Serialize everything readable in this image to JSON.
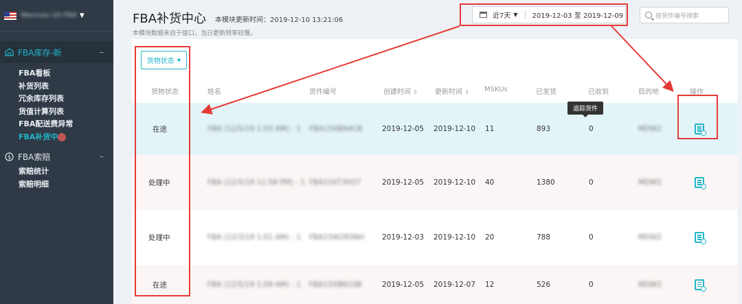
{
  "sidebar": {
    "store_name": "Warsvas US-FBA",
    "groups": [
      {
        "label": "FBA库存-新",
        "toggle": "–",
        "items": [
          "FBA看板",
          "补货列表",
          "冗余库存列表",
          "货值计算列表",
          "FBA配送费异常",
          "FBA补货中心"
        ]
      },
      {
        "label": "FBA索赔",
        "toggle": "–",
        "items": [
          "索赔统计",
          "索赔明细"
        ]
      }
    ]
  },
  "header": {
    "title": "FBA补货中心",
    "update_time": "本模块更新时间：2019-12-10 13:21:06",
    "note": "本模块数据来自于接口，当日更新频率较慢。"
  },
  "date_filter": {
    "preset": "近7天",
    "range": "2019-12-03 至 2019-12-09"
  },
  "search": {
    "placeholder": "按货件编号搜索"
  },
  "status_filter": {
    "label": "货物状态"
  },
  "table": {
    "columns": [
      "货物状态",
      "姓名",
      "货件编号",
      "创建时间",
      "更新时间",
      "MSKUs",
      "已发货",
      "已收到",
      "目的地",
      "操作"
    ],
    "sort_glyph": "⇕",
    "rows": [
      {
        "status": "在途",
        "name": "FBA (12/5/19 1:03 AM) - 1",
        "shipment_id": "FBA15XBN4CB",
        "created": "2019-12-05",
        "updated": "2019-12-10",
        "mskus": "11",
        "shipped": "893",
        "received": "0",
        "destination": "MDW2"
      },
      {
        "status": "处理中",
        "name": "FBA (12/5/19 11:58 PM) - 1",
        "shipment_id": "FBA15XT3H37",
        "created": "2019-12-05",
        "updated": "2019-12-10",
        "mskus": "40",
        "shipped": "1380",
        "received": "0",
        "destination": "MDW2"
      },
      {
        "status": "处理中",
        "name": "FBA (12/3/19 1:01 AM) - 1",
        "shipment_id": "FBA15W2R0NH",
        "created": "2019-12-03",
        "updated": "2019-12-10",
        "mskus": "20",
        "shipped": "788",
        "received": "0",
        "destination": "MDW2"
      },
      {
        "status": "在途",
        "name": "FBA (12/5/19 1:09 AM) - 1",
        "shipment_id": "FBA15XBN10B",
        "created": "2019-12-05",
        "updated": "2019-12-07",
        "mskus": "12",
        "shipped": "526",
        "received": "0",
        "destination": "MDW2"
      }
    ]
  },
  "tooltip": {
    "label": "追踪货件"
  },
  "icons": {
    "store_flag": "us-flag-icon",
    "warehouse": "warehouse-icon",
    "claims": "dollar-circle-icon",
    "calendar": "calendar-icon",
    "search": "search-icon",
    "track": "track-shipment-icon"
  },
  "colors": {
    "accent": "#21b5c8",
    "sidebar_bg": "#2f3a46",
    "highlight_row": "#e3f4f9",
    "annotation": "#e53935"
  }
}
